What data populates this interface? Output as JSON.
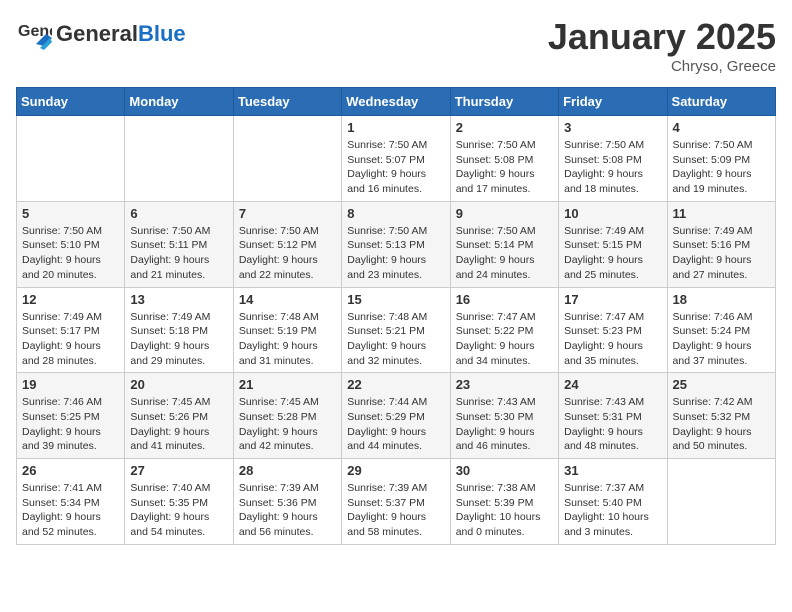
{
  "header": {
    "logo_general": "General",
    "logo_blue": "Blue",
    "month_title": "January 2025",
    "location": "Chryso, Greece"
  },
  "weekdays": [
    "Sunday",
    "Monday",
    "Tuesday",
    "Wednesday",
    "Thursday",
    "Friday",
    "Saturday"
  ],
  "weeks": [
    [
      {
        "day": "",
        "info": ""
      },
      {
        "day": "",
        "info": ""
      },
      {
        "day": "",
        "info": ""
      },
      {
        "day": "1",
        "info": "Sunrise: 7:50 AM\nSunset: 5:07 PM\nDaylight: 9 hours and 16 minutes."
      },
      {
        "day": "2",
        "info": "Sunrise: 7:50 AM\nSunset: 5:08 PM\nDaylight: 9 hours and 17 minutes."
      },
      {
        "day": "3",
        "info": "Sunrise: 7:50 AM\nSunset: 5:08 PM\nDaylight: 9 hours and 18 minutes."
      },
      {
        "day": "4",
        "info": "Sunrise: 7:50 AM\nSunset: 5:09 PM\nDaylight: 9 hours and 19 minutes."
      }
    ],
    [
      {
        "day": "5",
        "info": "Sunrise: 7:50 AM\nSunset: 5:10 PM\nDaylight: 9 hours and 20 minutes."
      },
      {
        "day": "6",
        "info": "Sunrise: 7:50 AM\nSunset: 5:11 PM\nDaylight: 9 hours and 21 minutes."
      },
      {
        "day": "7",
        "info": "Sunrise: 7:50 AM\nSunset: 5:12 PM\nDaylight: 9 hours and 22 minutes."
      },
      {
        "day": "8",
        "info": "Sunrise: 7:50 AM\nSunset: 5:13 PM\nDaylight: 9 hours and 23 minutes."
      },
      {
        "day": "9",
        "info": "Sunrise: 7:50 AM\nSunset: 5:14 PM\nDaylight: 9 hours and 24 minutes."
      },
      {
        "day": "10",
        "info": "Sunrise: 7:49 AM\nSunset: 5:15 PM\nDaylight: 9 hours and 25 minutes."
      },
      {
        "day": "11",
        "info": "Sunrise: 7:49 AM\nSunset: 5:16 PM\nDaylight: 9 hours and 27 minutes."
      }
    ],
    [
      {
        "day": "12",
        "info": "Sunrise: 7:49 AM\nSunset: 5:17 PM\nDaylight: 9 hours and 28 minutes."
      },
      {
        "day": "13",
        "info": "Sunrise: 7:49 AM\nSunset: 5:18 PM\nDaylight: 9 hours and 29 minutes."
      },
      {
        "day": "14",
        "info": "Sunrise: 7:48 AM\nSunset: 5:19 PM\nDaylight: 9 hours and 31 minutes."
      },
      {
        "day": "15",
        "info": "Sunrise: 7:48 AM\nSunset: 5:21 PM\nDaylight: 9 hours and 32 minutes."
      },
      {
        "day": "16",
        "info": "Sunrise: 7:47 AM\nSunset: 5:22 PM\nDaylight: 9 hours and 34 minutes."
      },
      {
        "day": "17",
        "info": "Sunrise: 7:47 AM\nSunset: 5:23 PM\nDaylight: 9 hours and 35 minutes."
      },
      {
        "day": "18",
        "info": "Sunrise: 7:46 AM\nSunset: 5:24 PM\nDaylight: 9 hours and 37 minutes."
      }
    ],
    [
      {
        "day": "19",
        "info": "Sunrise: 7:46 AM\nSunset: 5:25 PM\nDaylight: 9 hours and 39 minutes."
      },
      {
        "day": "20",
        "info": "Sunrise: 7:45 AM\nSunset: 5:26 PM\nDaylight: 9 hours and 41 minutes."
      },
      {
        "day": "21",
        "info": "Sunrise: 7:45 AM\nSunset: 5:28 PM\nDaylight: 9 hours and 42 minutes."
      },
      {
        "day": "22",
        "info": "Sunrise: 7:44 AM\nSunset: 5:29 PM\nDaylight: 9 hours and 44 minutes."
      },
      {
        "day": "23",
        "info": "Sunrise: 7:43 AM\nSunset: 5:30 PM\nDaylight: 9 hours and 46 minutes."
      },
      {
        "day": "24",
        "info": "Sunrise: 7:43 AM\nSunset: 5:31 PM\nDaylight: 9 hours and 48 minutes."
      },
      {
        "day": "25",
        "info": "Sunrise: 7:42 AM\nSunset: 5:32 PM\nDaylight: 9 hours and 50 minutes."
      }
    ],
    [
      {
        "day": "26",
        "info": "Sunrise: 7:41 AM\nSunset: 5:34 PM\nDaylight: 9 hours and 52 minutes."
      },
      {
        "day": "27",
        "info": "Sunrise: 7:40 AM\nSunset: 5:35 PM\nDaylight: 9 hours and 54 minutes."
      },
      {
        "day": "28",
        "info": "Sunrise: 7:39 AM\nSunset: 5:36 PM\nDaylight: 9 hours and 56 minutes."
      },
      {
        "day": "29",
        "info": "Sunrise: 7:39 AM\nSunset: 5:37 PM\nDaylight: 9 hours and 58 minutes."
      },
      {
        "day": "30",
        "info": "Sunrise: 7:38 AM\nSunset: 5:39 PM\nDaylight: 10 hours and 0 minutes."
      },
      {
        "day": "31",
        "info": "Sunrise: 7:37 AM\nSunset: 5:40 PM\nDaylight: 10 hours and 3 minutes."
      },
      {
        "day": "",
        "info": ""
      }
    ]
  ]
}
